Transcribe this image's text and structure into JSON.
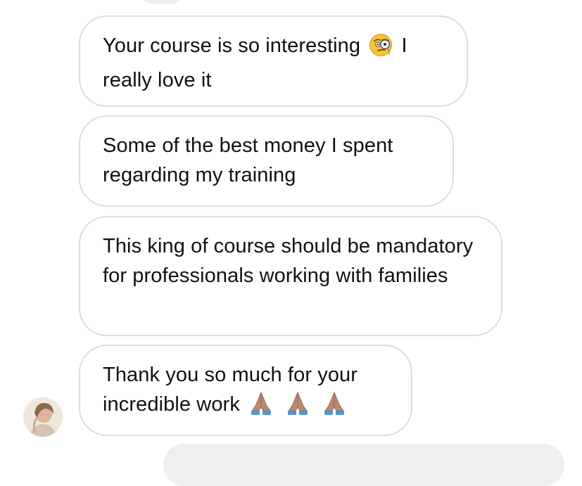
{
  "messages": [
    {
      "text_before": "Your course is so interesting",
      "emoji": "monocle-face-emoji",
      "text_after": " I really love it"
    },
    {
      "text": "Some of the best money I spent regarding my training"
    },
    {
      "text": "This king of course should be mandatory for professionals working with families"
    },
    {
      "text": "Thank you so much for your incredible work",
      "emojis": [
        "folded-hands-emoji",
        "folded-hands-emoji",
        "folded-hands-emoji"
      ]
    }
  ],
  "colors": {
    "bubble_border": "#dddddd",
    "bubble_background": "#ffffff",
    "text": "#111111",
    "partial_bubble": "#efefef",
    "emoji_skin": "#b98a6d",
    "emoji_sleeve": "#4f96d8",
    "monocle_face": "#f7c23c"
  },
  "avatar": {
    "icon": "profile-photo"
  }
}
